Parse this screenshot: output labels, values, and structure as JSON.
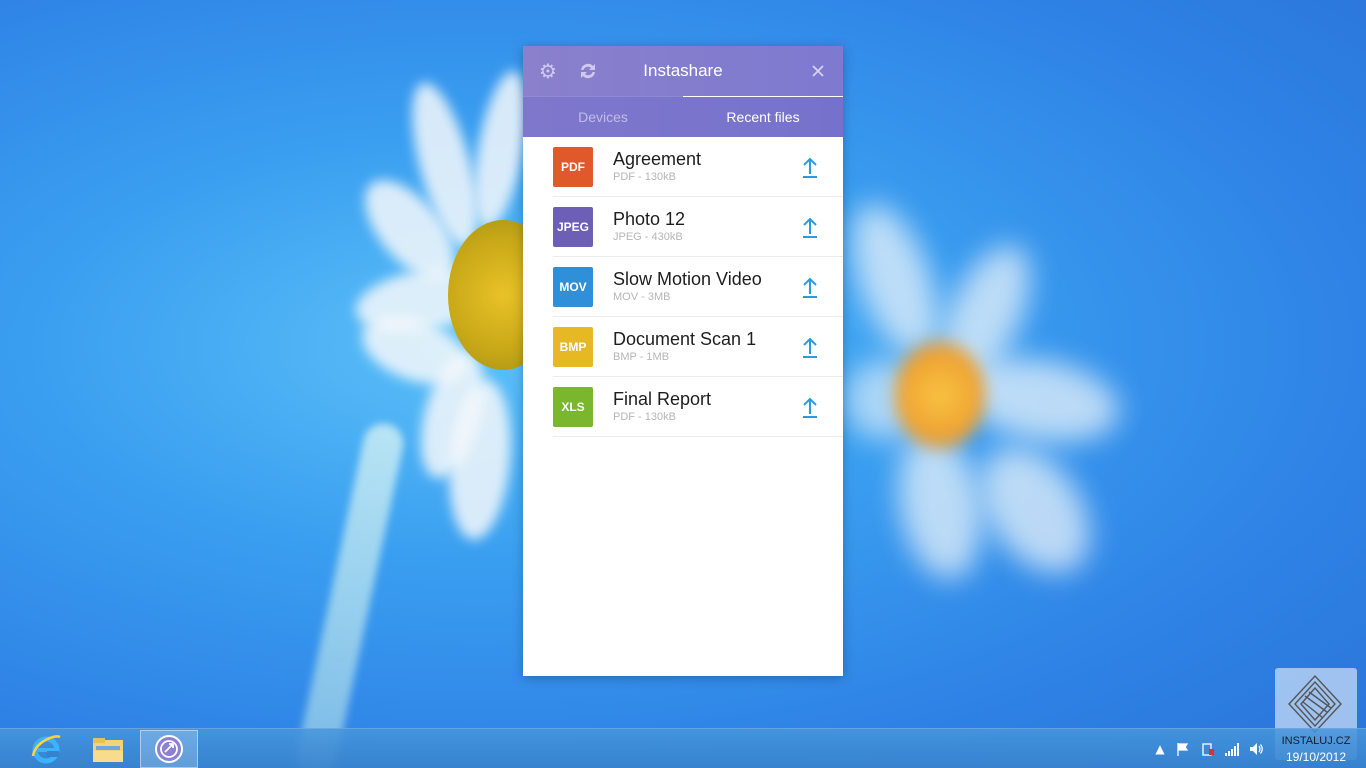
{
  "app": {
    "title": "Instashare",
    "icons": {
      "settings": "gear-icon",
      "refresh": "refresh-icon",
      "close": "close-icon"
    },
    "tabs": [
      {
        "label": "Devices",
        "active": false
      },
      {
        "label": "Recent files",
        "active": true
      }
    ],
    "files": [
      {
        "badge": "PDF",
        "badge_color": "#e0592a",
        "name": "Agreement",
        "meta": "PDF - 130kB",
        "icon": "upload-icon"
      },
      {
        "badge": "JPEG",
        "badge_color": "#6c5fb5",
        "name": "Photo 12",
        "meta": "JPEG - 430kB",
        "icon": "upload-icon"
      },
      {
        "badge": "MOV",
        "badge_color": "#2f8fd8",
        "name": "Slow Motion Video",
        "meta": "MOV - 3MB",
        "icon": "upload-icon"
      },
      {
        "badge": "BMP",
        "badge_color": "#e6b824",
        "name": "Document Scan 1",
        "meta": "BMP - 1MB",
        "icon": "upload-icon"
      },
      {
        "badge": "XLS",
        "badge_color": "#7ab72e",
        "name": "Final Report",
        "meta": "PDF - 130kB",
        "icon": "upload-icon"
      }
    ],
    "colors": {
      "header": "#8a80cc",
      "accent": "#2a9be0"
    }
  },
  "taskbar": {
    "items": [
      {
        "name": "internet-explorer",
        "icon": "internet-explorer-icon"
      },
      {
        "name": "file-explorer",
        "icon": "folder-icon"
      },
      {
        "name": "instashare",
        "icon": "instashare-icon",
        "active": true
      }
    ],
    "tray": [
      "show-hidden-icons-icon",
      "flag-icon",
      "power-icon",
      "network-icon",
      "volume-icon"
    ],
    "date": "19/10/2012"
  },
  "watermark": {
    "text": "INSTALUJ.CZ"
  }
}
